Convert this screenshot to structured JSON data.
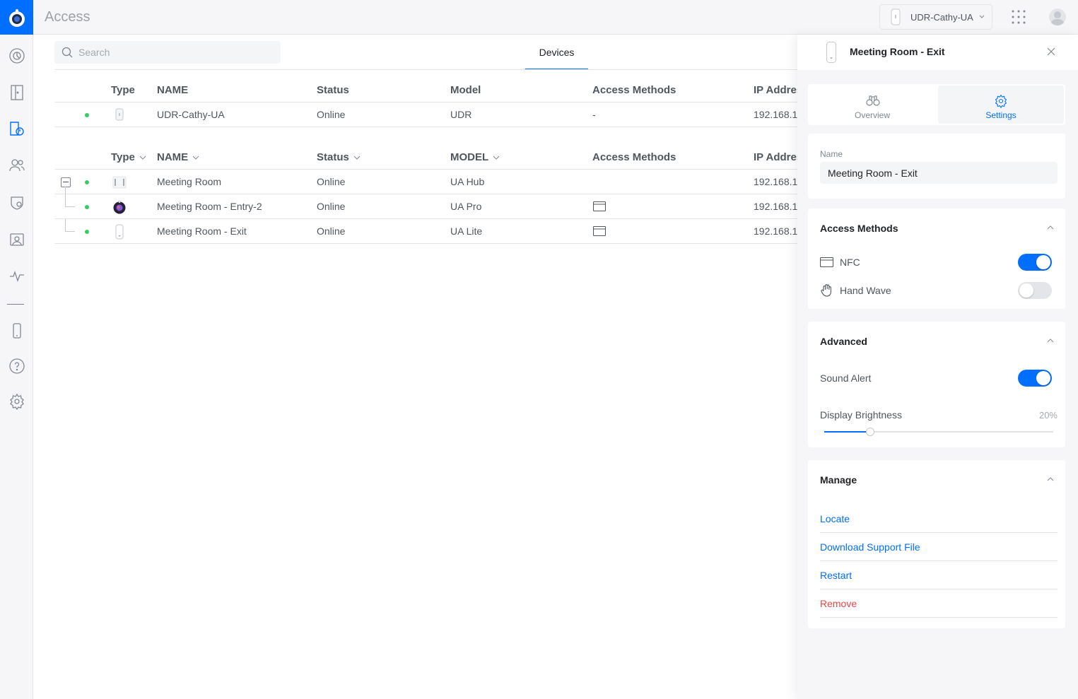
{
  "app": {
    "title": "Access"
  },
  "topbar": {
    "device_select": "UDR-Cathy-UA"
  },
  "search": {
    "placeholder": "Search"
  },
  "tabs": {
    "devices": "Devices"
  },
  "table1": {
    "headers": {
      "type": "Type",
      "name": "NAME",
      "status": "Status",
      "model": "Model",
      "access": "Access Methods",
      "ip": "IP Address"
    },
    "rows": [
      {
        "name": "UDR-Cathy-UA",
        "status": "Online",
        "model": "UDR",
        "access": "-",
        "ip": "192.168.1."
      }
    ]
  },
  "table2": {
    "headers": {
      "type": "Type",
      "name": "NAME",
      "status": "Status",
      "model": "MODEL",
      "access": "Access Methods",
      "ip": "IP Address"
    },
    "rows": [
      {
        "name": "Meeting Room",
        "status": "Online",
        "model": "UA Hub",
        "ip": "192.168.1."
      },
      {
        "name": "Meeting Room - Entry-2",
        "status": "Online",
        "model": "UA Pro",
        "ip": "192.168.1."
      },
      {
        "name": "Meeting Room - Exit",
        "status": "Online",
        "model": "UA Lite",
        "ip": "192.168.1."
      }
    ]
  },
  "panel": {
    "title": "Meeting Room - Exit",
    "tabs": {
      "overview": "Overview",
      "settings": "Settings"
    },
    "name_label": "Name",
    "name_value": "Meeting Room - Exit",
    "access_methods": {
      "title": "Access Methods",
      "nfc": {
        "label": "NFC",
        "enabled": true
      },
      "hand_wave": {
        "label": "Hand Wave",
        "enabled": false
      }
    },
    "advanced": {
      "title": "Advanced",
      "sound_alert": {
        "label": "Sound Alert",
        "enabled": true
      },
      "brightness": {
        "label": "Display Brightness",
        "value_text": "20%",
        "value": 0.2
      }
    },
    "manage": {
      "title": "Manage",
      "locate": "Locate",
      "download": "Download Support File",
      "restart": "Restart",
      "remove": "Remove"
    }
  },
  "colors": {
    "accent": "#006fff",
    "online": "#39cc64",
    "danger": "#ee4444"
  }
}
